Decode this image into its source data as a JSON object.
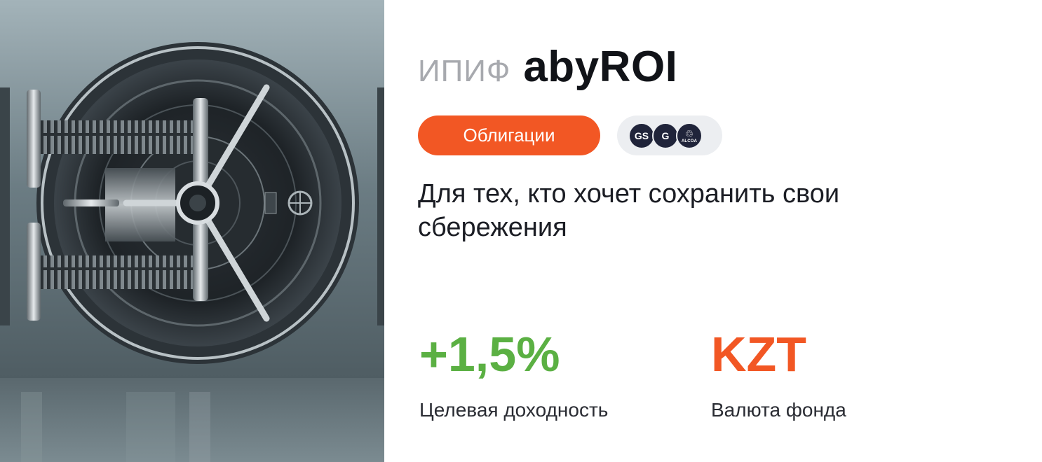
{
  "fund": {
    "prefix": "ИПИФ",
    "name": "abyROI",
    "category_tag": "Облигации",
    "description": "Для тех, кто хочет сохранить свои сбережения"
  },
  "holdings_logos": [
    {
      "icon": "gs-logo-icon",
      "text": "GS"
    },
    {
      "icon": "gazprom-logo-icon",
      "text": "G"
    },
    {
      "icon": "alcoa-logo-icon",
      "text": "ALCOA"
    }
  ],
  "stats": {
    "yield": {
      "value": "+1,5%",
      "label": "Целевая доходность"
    },
    "currency": {
      "value": "KZT",
      "label": "Валюта фонда"
    }
  },
  "colors": {
    "accent_orange": "#f25724",
    "yield_green": "#5bb043",
    "currency_orange": "#f25724",
    "prefix_gray": "#a7a9ae"
  }
}
